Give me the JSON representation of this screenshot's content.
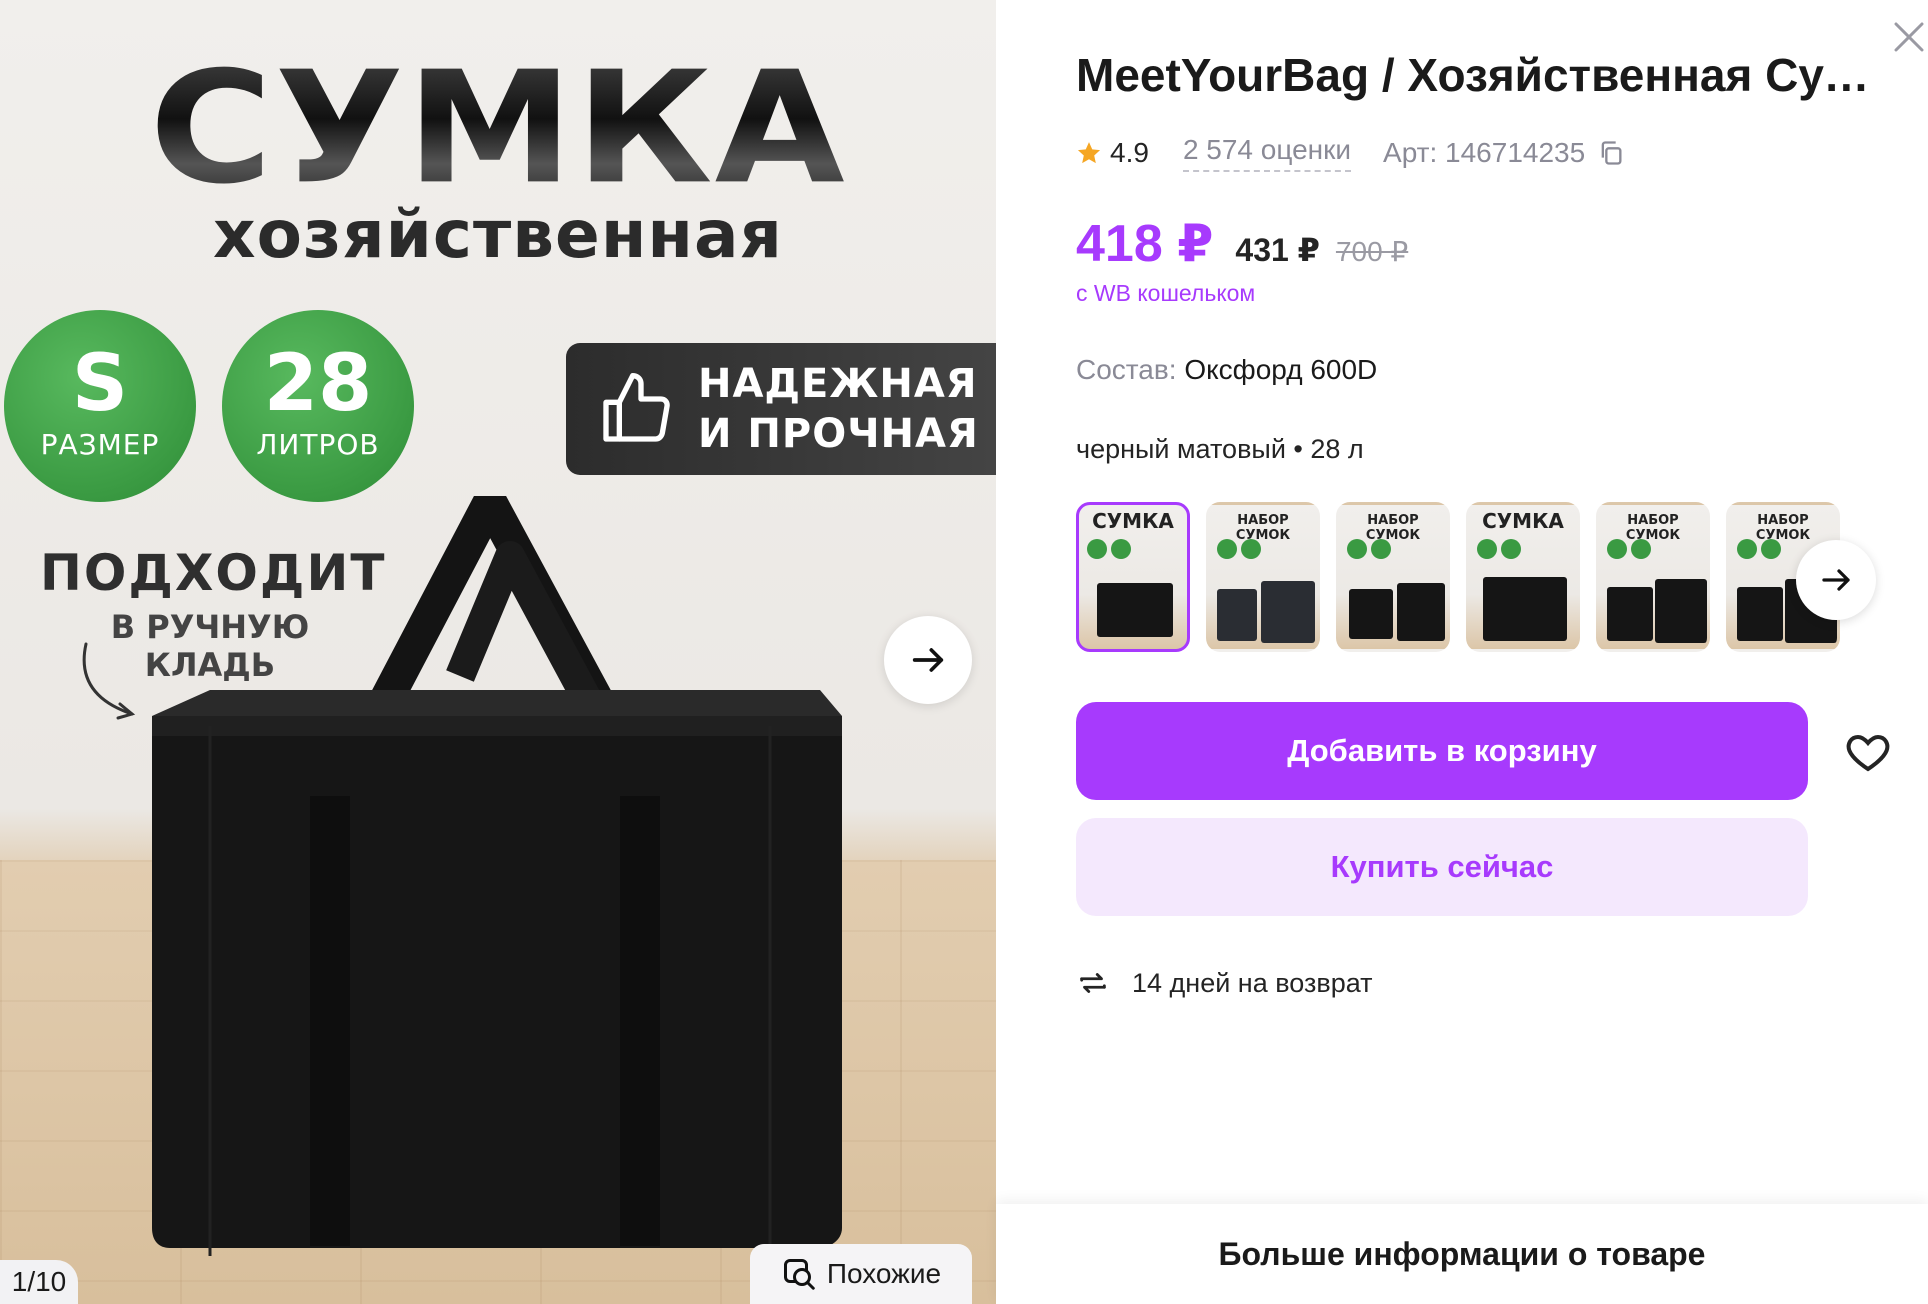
{
  "gallery": {
    "hero_title": "СУМКА",
    "hero_subtitle": "хозяйственная",
    "size_badge": {
      "value": "S",
      "label": "РАЗМЕР"
    },
    "volume_badge": {
      "value": "28",
      "label": "ЛИТРОВ"
    },
    "quality_badge": {
      "line1": "НАДЕЖНАЯ",
      "line2": "И ПРОЧНАЯ",
      "icon": "thumbs-up-icon"
    },
    "fits_text": {
      "line1": "ПОДХОДИТ",
      "line2": "В РУЧНУЮ КЛАДЬ"
    },
    "counter": "1/10",
    "similar_label": "Похожие",
    "next_icon": "arrow-right-icon"
  },
  "product": {
    "title": "MeetYourBag / Хозяйственная Сумка хозяйственная",
    "rating": "4.9",
    "reviews": "2 574 оценки",
    "article": "Арт: 146714235",
    "price_wallet": "418 ₽",
    "price_regular": "431 ₽",
    "price_old": "700 ₽",
    "wallet_note": "с WB кошельком",
    "composition_label": "Состав:",
    "composition_value": "Оксфорд 600D",
    "variant": "черный матовый • 28 л",
    "thumbnails": [
      {
        "title": "СУМКА",
        "active": true
      },
      {
        "title": "НАБОР СУМОК",
        "active": false
      },
      {
        "title": "НАБОР СУМОК",
        "active": false
      },
      {
        "title": "СУМКА",
        "active": false
      },
      {
        "title": "НАБОР СУМОК",
        "active": false
      },
      {
        "title": "НАБОР СУМОК",
        "active": false
      }
    ],
    "add_to_cart": "Добавить в корзину",
    "buy_now": "Купить сейчас",
    "returns": "14 дней на возврат",
    "more_info": "Больше информации о товаре"
  },
  "colors": {
    "accent": "#a73afd",
    "accent_light": "#f4e8fd",
    "badge_green": "#3a9a42",
    "star": "#f5a623"
  }
}
